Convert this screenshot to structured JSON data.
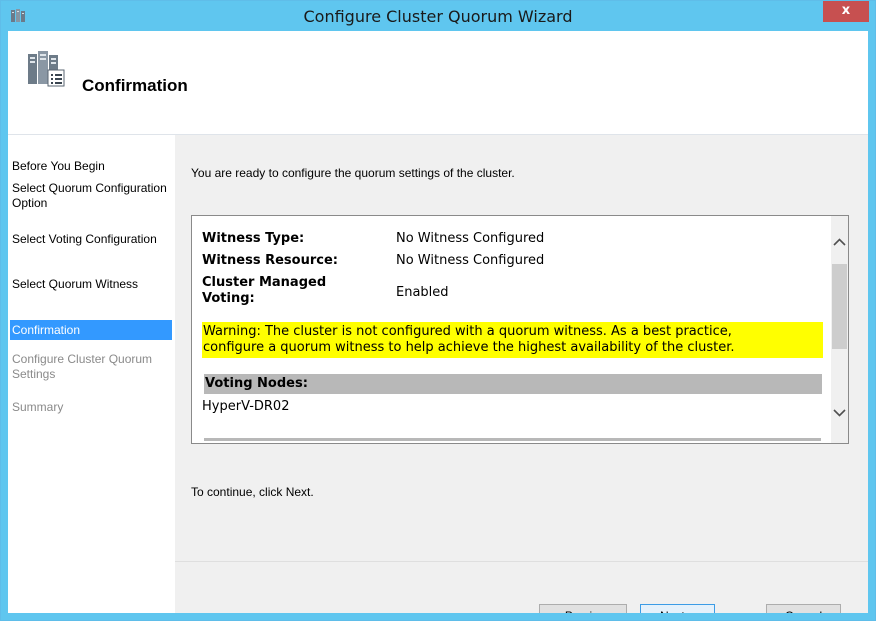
{
  "window": {
    "title": "Configure Cluster Quorum Wizard",
    "close_label": "x"
  },
  "header": {
    "title": "Confirmation"
  },
  "nav": {
    "items": [
      {
        "label": "Before You Begin",
        "state": "normal"
      },
      {
        "label": "Select Quorum Configuration Option",
        "state": "normal"
      },
      {
        "label": "Select Voting Configuration",
        "state": "normal"
      },
      {
        "label": "Select Quorum Witness",
        "state": "normal"
      },
      {
        "label": "Confirmation",
        "state": "active"
      },
      {
        "label": "Configure Cluster Quorum Settings",
        "state": "disabled"
      },
      {
        "label": "Summary",
        "state": "disabled"
      }
    ]
  },
  "main": {
    "intro": "You are ready to configure the quorum settings of the cluster.",
    "summary": {
      "witness_type_label": "Witness Type:",
      "witness_type_value": "No Witness Configured",
      "witness_resource_label": "Witness Resource:",
      "witness_resource_value": "No Witness Configured",
      "managed_voting_label_1": "Cluster Managed",
      "managed_voting_label_2": "Voting:",
      "managed_voting_value": "Enabled",
      "warning_line_1": "Warning: The cluster is not configured with a quorum witness. As a best practice,",
      "warning_line_2": "configure a quorum witness to help achieve the highest availability of the cluster.",
      "voting_nodes_header": "Voting Nodes:",
      "voting_nodes": [
        "HyperV-DR02"
      ]
    },
    "continue_text": "To continue, click Next."
  },
  "buttons": {
    "previous": "< Previous",
    "next": "Next >",
    "cancel": "Cancel"
  },
  "colors": {
    "titlebar": "#5fc6ef",
    "nav_active": "#3399ff",
    "warning_bg": "#ffff00",
    "close_button": "#c75050"
  }
}
